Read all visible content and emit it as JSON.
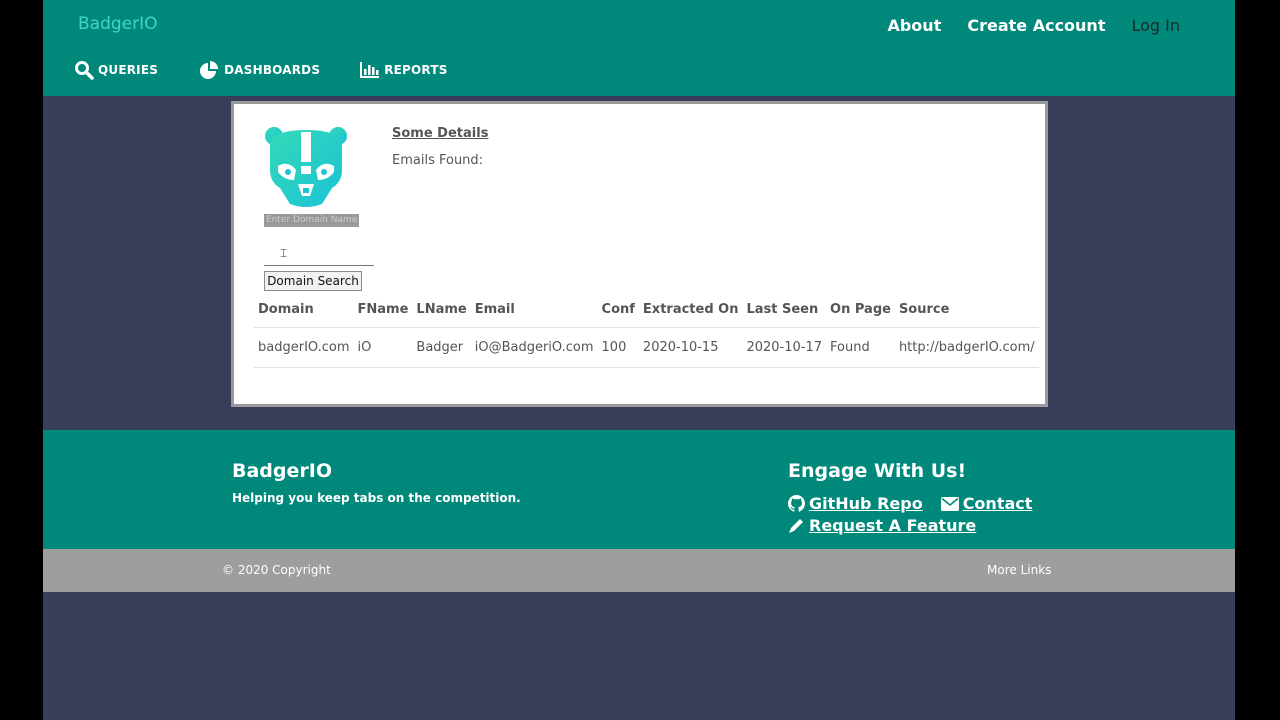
{
  "header": {
    "brand": "BadgerIO",
    "nav": {
      "about": "About",
      "create_account": "Create Account",
      "login": "Log In"
    },
    "subnav": [
      {
        "label": "QUERIES",
        "icon": "search-icon"
      },
      {
        "label": "DASHBOARDS",
        "icon": "pie-chart-icon"
      },
      {
        "label": "REPORTS",
        "icon": "bar-chart-icon"
      }
    ]
  },
  "card": {
    "logo_icon": "badger-logo-icon",
    "input_label": "Enter Domain Name",
    "input_value": "",
    "search_button": "Domain Search",
    "details_title": "Some Details",
    "emails_found": "Emails Found:",
    "table": {
      "columns": [
        "Domain",
        "FName",
        "LName",
        "Email",
        "Conf",
        "Extracted On",
        "Last Seen",
        "On Page",
        "Source"
      ],
      "rows": [
        [
          "badgerIO.com",
          "iO",
          "Badger",
          "iO@BadgeriO.com",
          "100",
          "2020-10-15",
          "2020-10-17",
          "Found",
          "http://badgerIO.com/"
        ]
      ]
    }
  },
  "footer": {
    "brand": "BadgerIO",
    "tagline": "Helping you keep tabs on the competition.",
    "engage_title": "Engage With Us!",
    "links": {
      "github": "GitHub Repo",
      "contact": "Contact",
      "request": "Request A Feature"
    },
    "copyright": "© 2020 Copyright",
    "more_links": "More Links"
  },
  "colors": {
    "teal": "#00897b",
    "navy": "#383e5a",
    "logo": "#2ed3c6",
    "gray_bar": "#9e9e9e"
  }
}
